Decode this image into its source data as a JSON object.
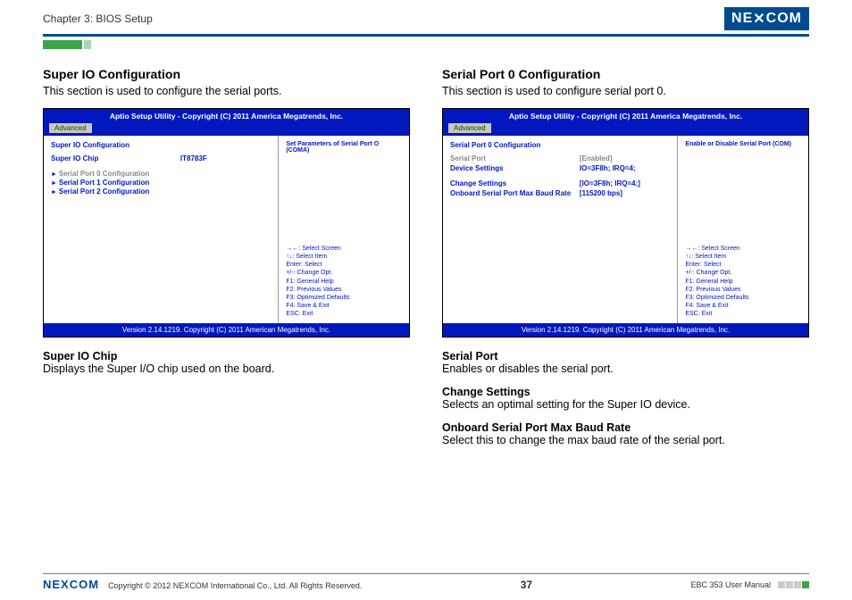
{
  "header": {
    "chapter": "Chapter 3: BIOS Setup",
    "brand": "NEXCOM"
  },
  "left": {
    "title": "Super IO Configuration",
    "desc": "This section is used to configure the serial ports.",
    "bios": {
      "top": "Aptio Setup Utility - Copyright (C) 2011 America Megatrends, Inc.",
      "tab": "Advanced",
      "heading": "Super IO Configuration",
      "chipLbl": "Super IO Chip",
      "chipVal": "IT8783F",
      "menu0": "Serial Port 0 Configuration",
      "menu1": "Serial Port 1 Configuration",
      "menu2": "Serial Port 2 Configuration",
      "help": "Set Parameters of Serial Port O (COMA)",
      "k1": "→←: Select Screen",
      "k2": "↑↓: Select Item",
      "k3": "Enter: Select",
      "k4": "+/-: Change Opt.",
      "k5": "F1: General Help",
      "k6": "F2: Previous Values",
      "k7": "F3: Optimized Defaults",
      "k8": "F4: Save & Exit",
      "k9": "ESC: Exit",
      "bot": "Version 2.14.1219. Copyright (C) 2011 American Megatrends, Inc."
    },
    "f1t": "Super IO Chip",
    "f1d": "Displays the Super I/O chip used on the board."
  },
  "right": {
    "title": "Serial Port 0 Configuration",
    "desc": "This section is used to configure serial port 0.",
    "bios": {
      "top": "Aptio Setup Utility - Copyright (C) 2011 America Megatrends, Inc.",
      "tab": "Advanced",
      "heading": "Serial Port 0 Configuration",
      "r1l": "Serial Port",
      "r1v": "[Enabled]",
      "r2l": "Device Settings",
      "r2v": "IO=3F8h; IRQ=4;",
      "r3l": "Change Settings",
      "r3v": "[IO=3F8h; IRQ=4;]",
      "r4l": "Onboard Serial Port Max Baud Rate",
      "r4v": "[115200 bps]",
      "help": "Enable or Disable Serial Port (COM)",
      "k1": "→←: Select Screen",
      "k2": "↑↓: Select Item",
      "k3": "Enter: Select",
      "k4": "+/-: Change Opt.",
      "k5": "F1: General Help",
      "k6": "F2: Previous Values",
      "k7": "F3: Optimized Defaults",
      "k8": "F4: Save & Exit",
      "k9": "ESC: Exit",
      "bot": "Version 2.14.1219. Copyright (C) 2011 American Megatrends, Inc."
    },
    "f1t": "Serial Port",
    "f1d": "Enables or disables the serial port.",
    "f2t": "Change Settings",
    "f2d": "Selects an optimal setting for the Super IO device.",
    "f3t": "Onboard Serial Port Max Baud Rate",
    "f3d": "Select this to change the max baud rate of the serial port."
  },
  "footer": {
    "brand": "NEXCOM",
    "copy": "Copyright © 2012 NEXCOM International Co., Ltd. All Rights Reserved.",
    "page": "37",
    "manual": "EBC 353 User Manual"
  }
}
